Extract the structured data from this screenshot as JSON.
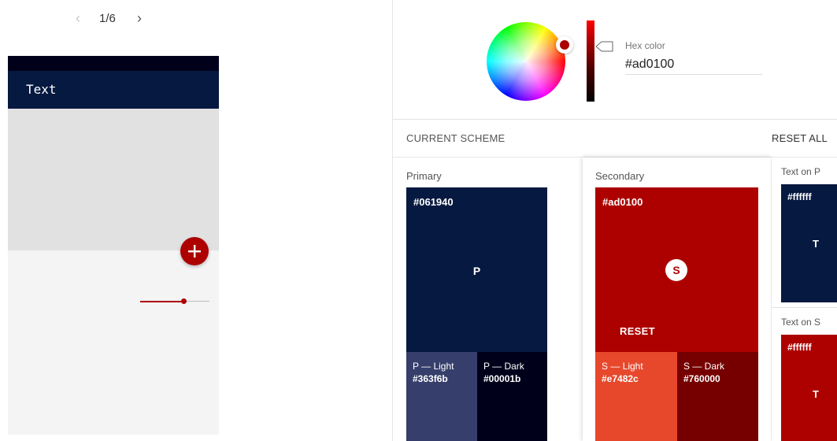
{
  "pager": {
    "prev": "‹",
    "count": "1/6",
    "next": "›"
  },
  "preview": {
    "app_bar_title": "Text",
    "fab_icon": "plus-icon",
    "slider_value": 0.62,
    "colors": {
      "primary": "#061940",
      "primary_dark": "#00001b",
      "secondary": "#ad0100",
      "surface": "#f4f4f5",
      "hero": "#e1e1e2"
    }
  },
  "picker": {
    "hex_label": "Hex color",
    "hex_value": "#ad0100"
  },
  "scheme": {
    "label": "CURRENT SCHEME",
    "reset_all": "RESET ALL",
    "primary": {
      "title": "Primary",
      "hex": "#061940",
      "letter": "P",
      "light": {
        "name": "P — Light",
        "hex": "#363f6b"
      },
      "dark": {
        "name": "P — Dark",
        "hex": "#00001b"
      }
    },
    "secondary": {
      "title": "Secondary",
      "hex": "#ad0100",
      "letter": "S",
      "reset": "RESET",
      "light": {
        "name": "S — Light",
        "hex": "#e7482c"
      },
      "dark": {
        "name": "S — Dark",
        "hex": "#760000"
      }
    },
    "text_on_p": {
      "title": "Text on P",
      "hex": "#ffffff",
      "letter": "T"
    },
    "text_on_s": {
      "title": "Text on S",
      "hex": "#ffffff",
      "letter": "T"
    }
  }
}
